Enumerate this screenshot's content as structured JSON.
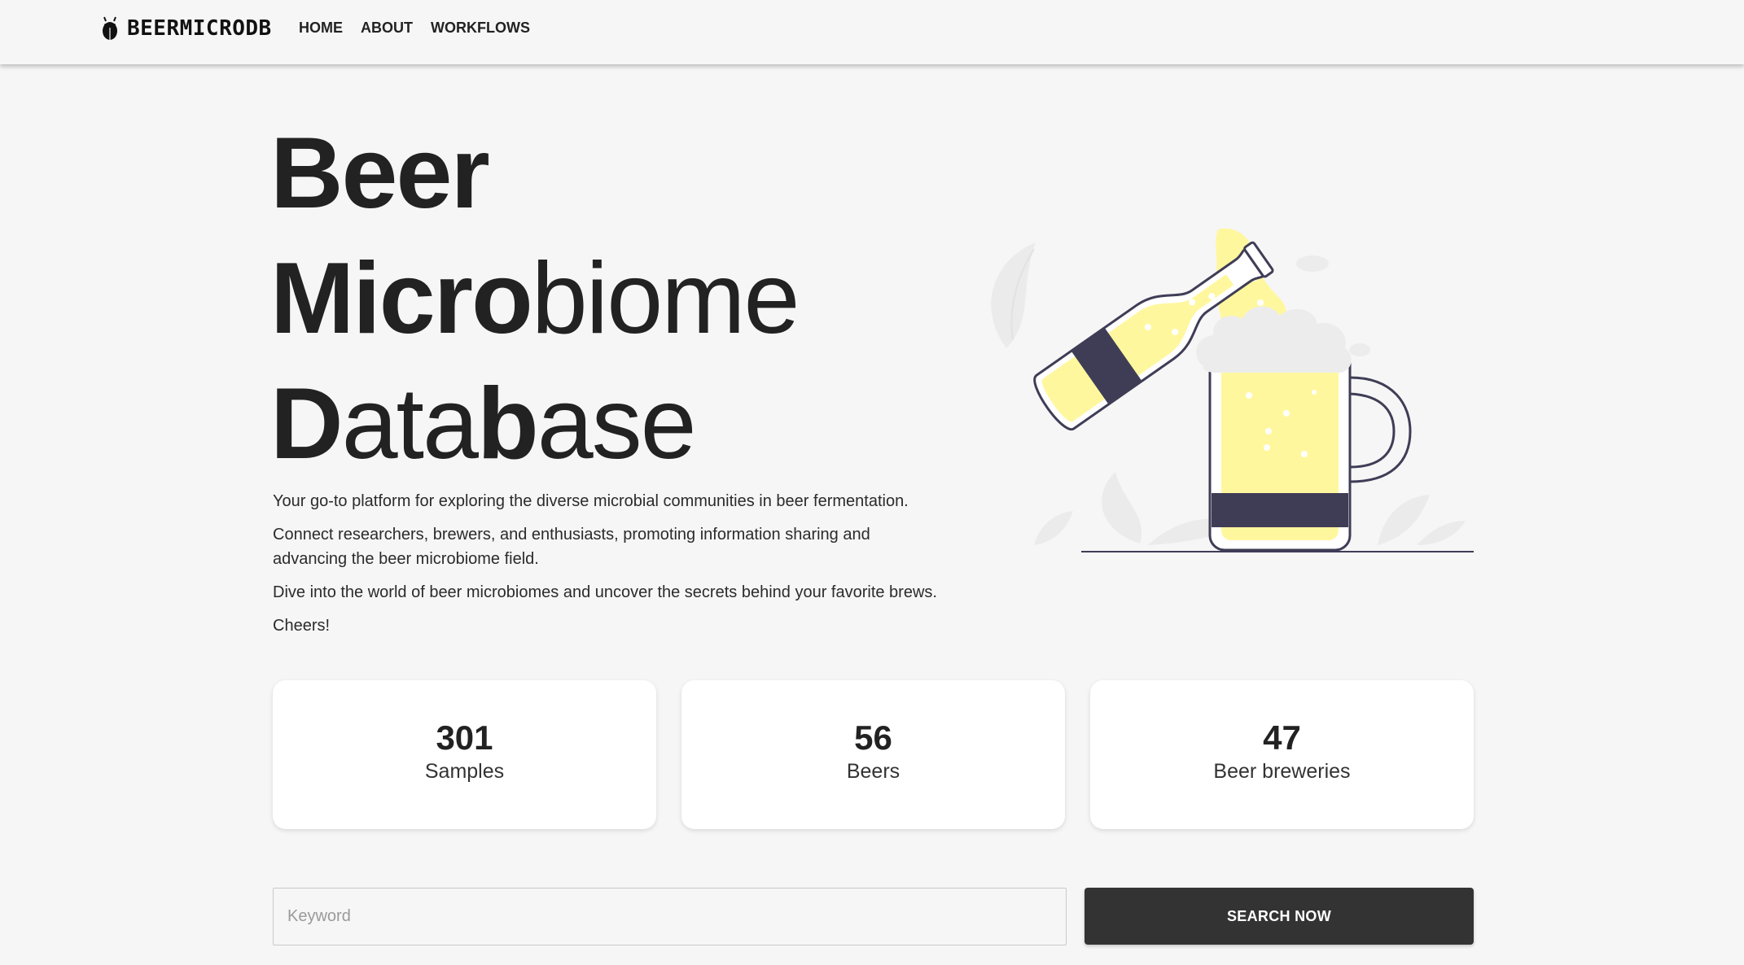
{
  "nav": {
    "brand": "BEERMICRODB",
    "links": [
      "HOME",
      "ABOUT",
      "WORKFLOWS"
    ]
  },
  "hero": {
    "line1": {
      "bold": "Beer"
    },
    "line2": {
      "bold": "Micro",
      "thin": "biome"
    },
    "line3": {
      "b1": "D",
      "t1": "ata",
      "b2": "b",
      "t2": "ase"
    },
    "paragraphs": [
      "Your go-to platform for exploring the diverse microbial communities in beer fermentation.",
      "Connect researchers, brewers, and enthusiasts, promoting information sharing and advancing the beer microbiome field.",
      "Dive into the world of beer microbiomes and uncover the secrets behind your favorite brews.",
      "Cheers!"
    ]
  },
  "stats": [
    {
      "value": "301",
      "label": "Samples"
    },
    {
      "value": "56",
      "label": "Beers"
    },
    {
      "value": "47",
      "label": "Beer breweries"
    }
  ],
  "search": {
    "placeholder": "Keyword",
    "value": "",
    "button_label": "SEARCH NOW"
  },
  "icons": {
    "brand": "beer-bug-icon",
    "illustration": "beer-pouring-illustration"
  },
  "colors": {
    "beer": "#fff79e",
    "band": "#3f3d56",
    "foam": "#ececec",
    "button": "#333333",
    "background": "#f6f6f6"
  }
}
